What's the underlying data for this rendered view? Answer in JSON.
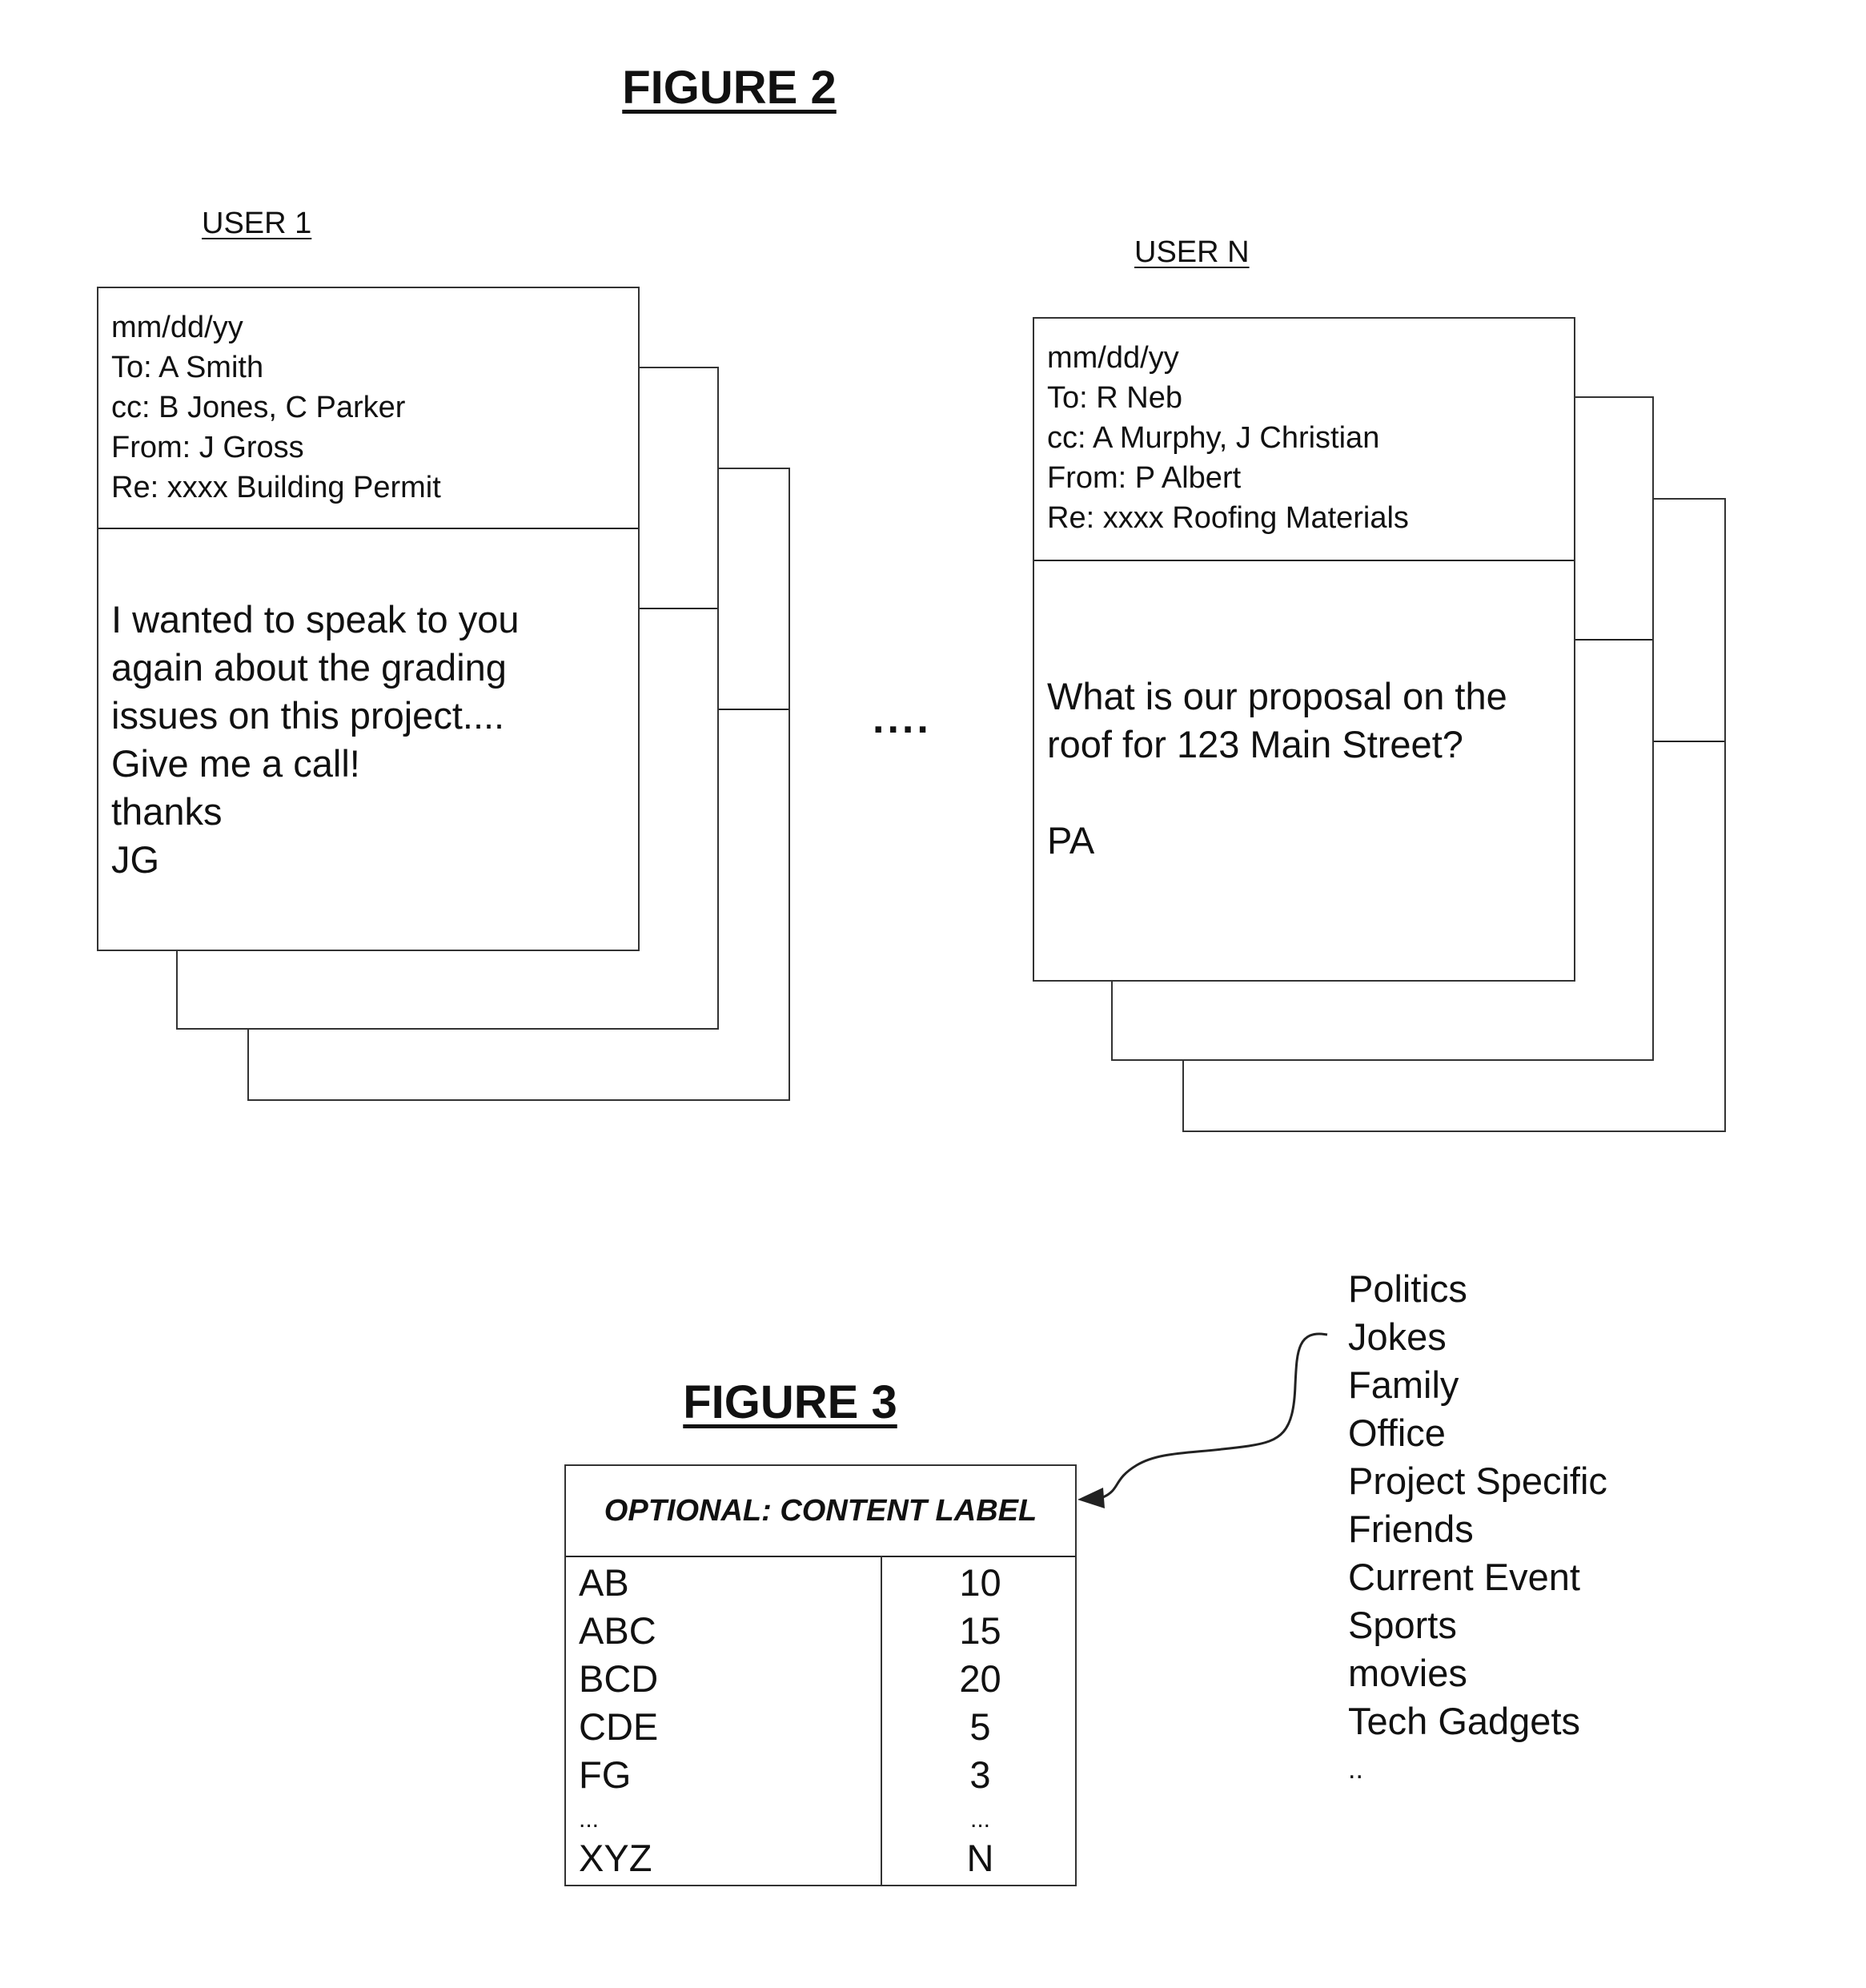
{
  "figure2": {
    "title": "FIGURE 2",
    "separator": "....",
    "users": [
      {
        "label": "USER 1",
        "email": {
          "date": "mm/dd/yy",
          "to": "To: A Smith",
          "cc": "cc: B Jones, C Parker",
          "from": "From: J Gross",
          "re": "Re: xxxx Building Permit",
          "body": [
            "I wanted to speak to you",
            "again about the grading",
            "issues on this project....",
            "Give me a call!",
            "thanks",
            "JG"
          ]
        }
      },
      {
        "label": "USER N",
        "email": {
          "date": "mm/dd/yy",
          "to": "To: R Neb",
          "cc": "cc: A Murphy, J Christian",
          "from": "From: P Albert",
          "re": "Re: xxxx Roofing Materials",
          "body": [
            "What is our proposal on the",
            "roof for 123 Main Street?",
            "",
            "PA"
          ]
        }
      }
    ]
  },
  "figure3": {
    "title": "FIGURE 3",
    "table": {
      "header": "OPTIONAL: CONTENT LABEL",
      "rows": [
        {
          "term": "AB",
          "count": "10"
        },
        {
          "term": "ABC",
          "count": "15"
        },
        {
          "term": "BCD",
          "count": "20"
        },
        {
          "term": "CDE",
          "count": "5"
        },
        {
          "term": "FG",
          "count": "3"
        },
        {
          "term": "...",
          "count": "..."
        },
        {
          "term": "XYZ",
          "count": "N"
        }
      ]
    },
    "content_labels": [
      "Politics",
      "Jokes",
      "Family",
      "Office",
      "Project Specific",
      "Friends",
      "Current Event",
      "Sports",
      "movies",
      "Tech Gadgets",
      ".."
    ]
  }
}
